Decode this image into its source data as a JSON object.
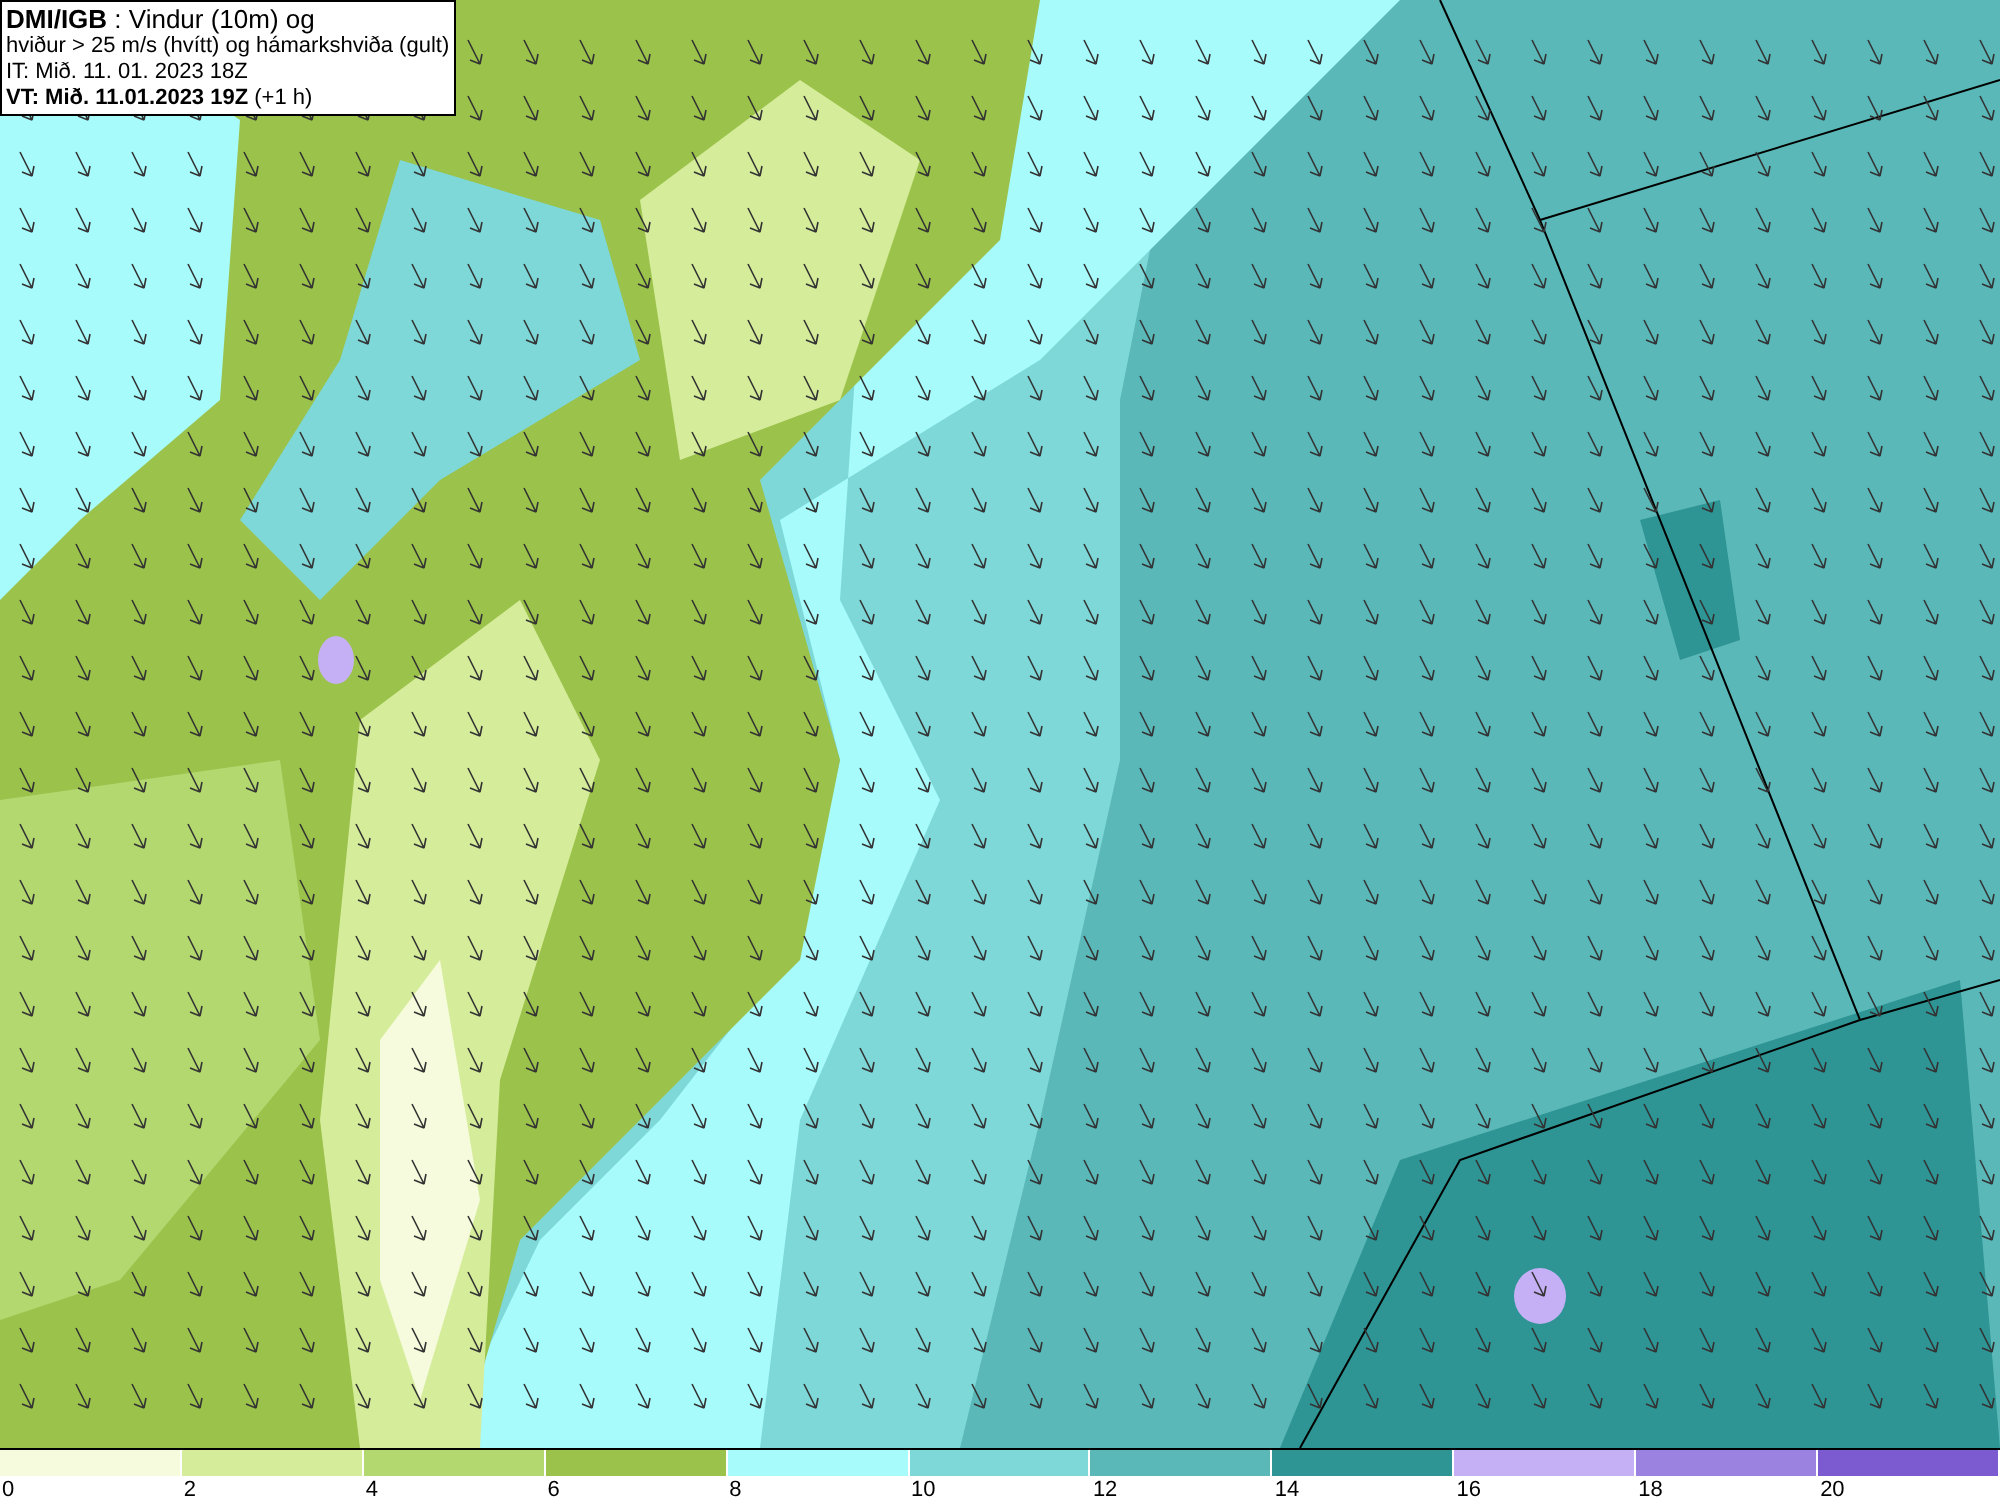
{
  "title_box": {
    "lines": [
      "**DMI/IGB** : Vindur (10m) og",
      "hviður > 25 m/s (hvítt) og hámarkshviða (gult)",
      "IT: Mið. 11. 01. 2023 18Z",
      "**VT: Mið. 11.01.2023 19Z** (+1 h)"
    ]
  },
  "legend": [
    {
      "label": "0",
      "color": "#f5fbdc"
    },
    {
      "label": "2",
      "color": "#d5ec9a"
    },
    {
      "label": "4",
      "color": "#b3d870"
    },
    {
      "label": "6",
      "color": "#9bc24a"
    },
    {
      "label": "8",
      "color": "#a8fbfb"
    },
    {
      "label": "10",
      "color": "#7ed8d8"
    },
    {
      "label": "12",
      "color": "#5bb8b8"
    },
    {
      "label": "14",
      "color": "#2e9494"
    },
    {
      "label": "16",
      "color": "#c5b0f5"
    },
    {
      "label": "18",
      "color": "#9b82e0"
    },
    {
      "label": "20",
      "color": "#7c5bd0"
    }
  ]
}
